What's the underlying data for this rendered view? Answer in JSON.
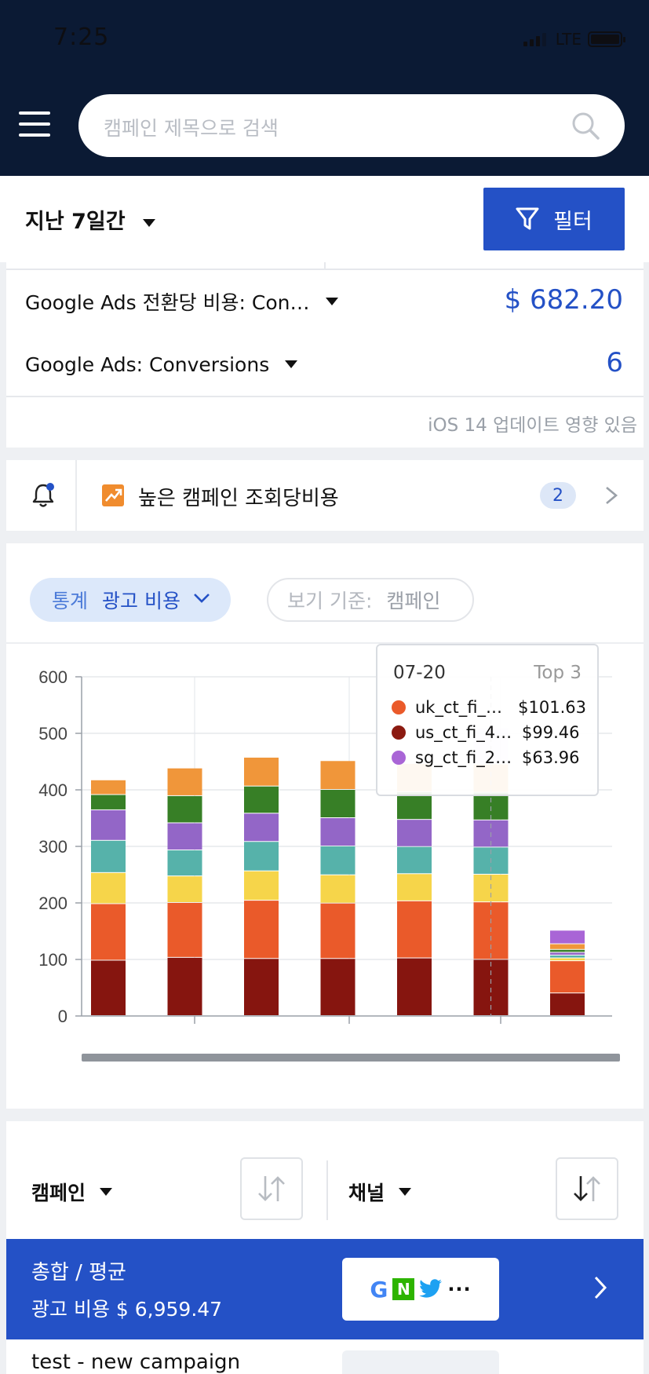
{
  "status_bar": {
    "time": "7:25",
    "network": "LTE"
  },
  "header": {
    "search_placeholder": "캠페인 제목으로 검색"
  },
  "toolbar": {
    "period": "지난 7일간",
    "filter_label": "필터"
  },
  "metrics": [
    {
      "label": "Google Ads 전환당 비용: Con…",
      "value": "$ 682.20"
    },
    {
      "label": "Google Ads: Conversions",
      "value": "6"
    }
  ],
  "ios_note": "iOS 14 업데이트 영향 있음",
  "alert": {
    "text": "높은 캠페인 조회당비용",
    "count": "2"
  },
  "chart_controls": {
    "stats_key": "통계",
    "stats_value": "광고 비용",
    "view_key": "보기 기준:",
    "view_value": "캠페인"
  },
  "tooltip": {
    "date": "07-20",
    "top": "Top 3",
    "rows": [
      {
        "name": "uk_ct_fi_…",
        "value": "$101.63",
        "color": "#ea5a2a"
      },
      {
        "name": "us_ct_fi_4…",
        "value": "$99.46",
        "color": "#8b1a10"
      },
      {
        "name": "sg_ct_fi_2…",
        "value": "$63.96",
        "color": "#a965d6"
      }
    ]
  },
  "chart_data": {
    "type": "bar",
    "stacked": true,
    "ylim": [
      0,
      600
    ],
    "yticks": [
      0,
      100,
      200,
      300,
      400,
      500,
      600
    ],
    "grid": true,
    "highlight_index": 5,
    "series": [
      {
        "color": "#86150f",
        "values": [
          98,
          103,
          101,
          101,
          102,
          99.46,
          40
        ]
      },
      {
        "color": "#ea5a2a",
        "values": [
          100,
          97,
          103,
          98,
          101,
          101.63,
          57
        ]
      },
      {
        "color": "#f6d54a",
        "values": [
          55,
          47,
          52,
          50,
          48,
          49,
          5
        ]
      },
      {
        "color": "#56b2aa",
        "values": [
          57,
          46,
          52,
          51,
          48,
          48,
          5
        ]
      },
      {
        "color": "#9366c7",
        "values": [
          54,
          48,
          50,
          50,
          48,
          48,
          5
        ]
      },
      {
        "color": "#377f26",
        "values": [
          27,
          48,
          48,
          50,
          49,
          49,
          5
        ]
      },
      {
        "color": "#f0963a",
        "values": [
          26,
          49,
          51,
          51,
          50,
          50,
          10
        ]
      },
      {
        "color": "#a965d6",
        "values": [
          0,
          0,
          0,
          0,
          0,
          63.96,
          24
        ]
      }
    ]
  },
  "table": {
    "col_campaign": "캠페인",
    "col_channel": "채널",
    "total_title": "총합 / 평균",
    "total_sub": "광고 비용 $ 6,959.47",
    "channel_more": "···",
    "row2_name": "test - new campaign"
  }
}
